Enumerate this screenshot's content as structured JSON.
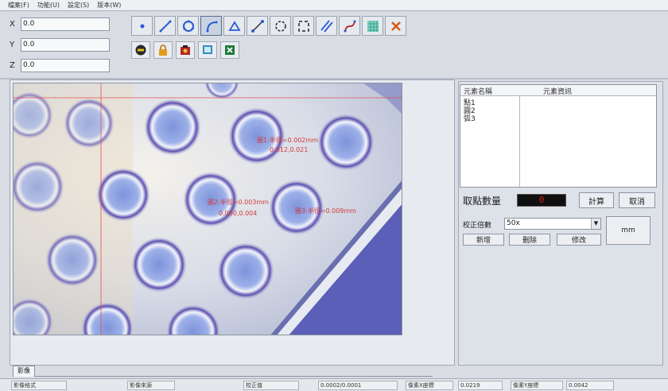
{
  "menubar": {
    "items": [
      "檔案(F)",
      "功能(U)",
      "設定(S)",
      "版本(W)"
    ]
  },
  "coords": {
    "x": {
      "label": "X",
      "value": "0.0"
    },
    "y": {
      "label": "Y",
      "value": "0.0"
    },
    "z": {
      "label": "Z",
      "value": "0.0"
    }
  },
  "toolbar": {
    "measure_tools": [
      "point-tool",
      "line-tool",
      "circle-tool",
      "arc-tool",
      "angle-tool",
      "distance-tool",
      "ellipse-tool",
      "rectangle-tool",
      "parallel-tool",
      "curve-tool",
      "grid-tool",
      "delete-tool"
    ],
    "action_tools": [
      "save-tool",
      "lock-tool",
      "camera-tool",
      "display-tool",
      "excel-export-tool"
    ]
  },
  "viewport": {
    "annotations": [
      "圓1:半徑=0.002mm",
      "0.012,0.021",
      "圓2:半徑=0.003mm",
      "0.000,0.004",
      "圓3:半徑=0.009mm"
    ],
    "tab_label": "影像"
  },
  "elements_panel": {
    "col_name": "元素名稱",
    "col_info": "元素資訊",
    "items": [
      "點1",
      "圓2",
      "弧3"
    ]
  },
  "points": {
    "label": "取點數量",
    "count": "0",
    "calc_button": "計算",
    "cancel_button": "取消"
  },
  "calibration": {
    "label": "校正倍數",
    "selected": "50x",
    "unit_button": "mm",
    "add_button": "新增",
    "delete_button": "刪除",
    "modify_button": "修改"
  },
  "statusbar": {
    "cells": [
      "影像格式",
      "影像來源",
      "校正值",
      "0.0002/0.0001",
      "像素X座標",
      "0.0219",
      "像素Y座標",
      "0.0042"
    ]
  },
  "colors": {
    "accent": "#3f7ad9",
    "annotation": "#d23b3b",
    "counter_bg": "#101010",
    "counter_fg": "#d02020"
  }
}
